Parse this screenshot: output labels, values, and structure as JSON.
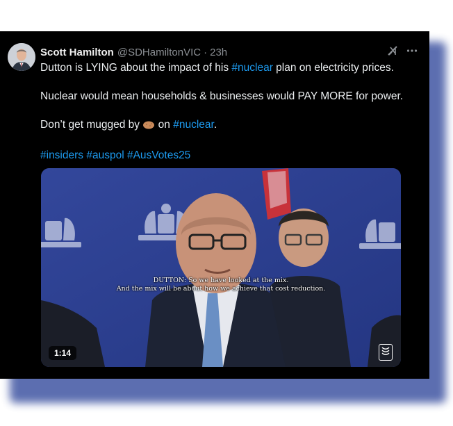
{
  "tweet": {
    "author_name": "Scott Hamilton",
    "handle": "@SDHamiltonVIC",
    "separator": "·",
    "time": "23h",
    "grok_icon": "grok-icon",
    "more_icon": "more-icon",
    "line1_text": "Dutton is LYING about the impact of his ",
    "line1_tag": "#nuclear",
    "line1_rest": " plan on electricity prices.",
    "line2": "Nuclear would mean households & businesses would PAY MORE for power.",
    "line3_text": "Don’t get mugged by ",
    "line3_emoji": "potato-emoji",
    "line3_on": " on ",
    "line3_tag": "#nuclear",
    "line3_end": ".",
    "hashtags": [
      "#insiders",
      "#auspol",
      "#AusVotes25"
    ]
  },
  "video": {
    "caption_line1": "DUTTON: So we have looked at the mix.",
    "caption_line2": "And the mix will be about how we achieve that cost reduction.",
    "duration": "1:14",
    "abc_logo": "abc-news-logo"
  },
  "colors": {
    "background": "#000000",
    "link": "#1d9bf0",
    "muted": "#8b8f94",
    "text": "#e7e9ea",
    "shadow": "#4b5fa8",
    "backdrop": "#2c3c8f"
  }
}
